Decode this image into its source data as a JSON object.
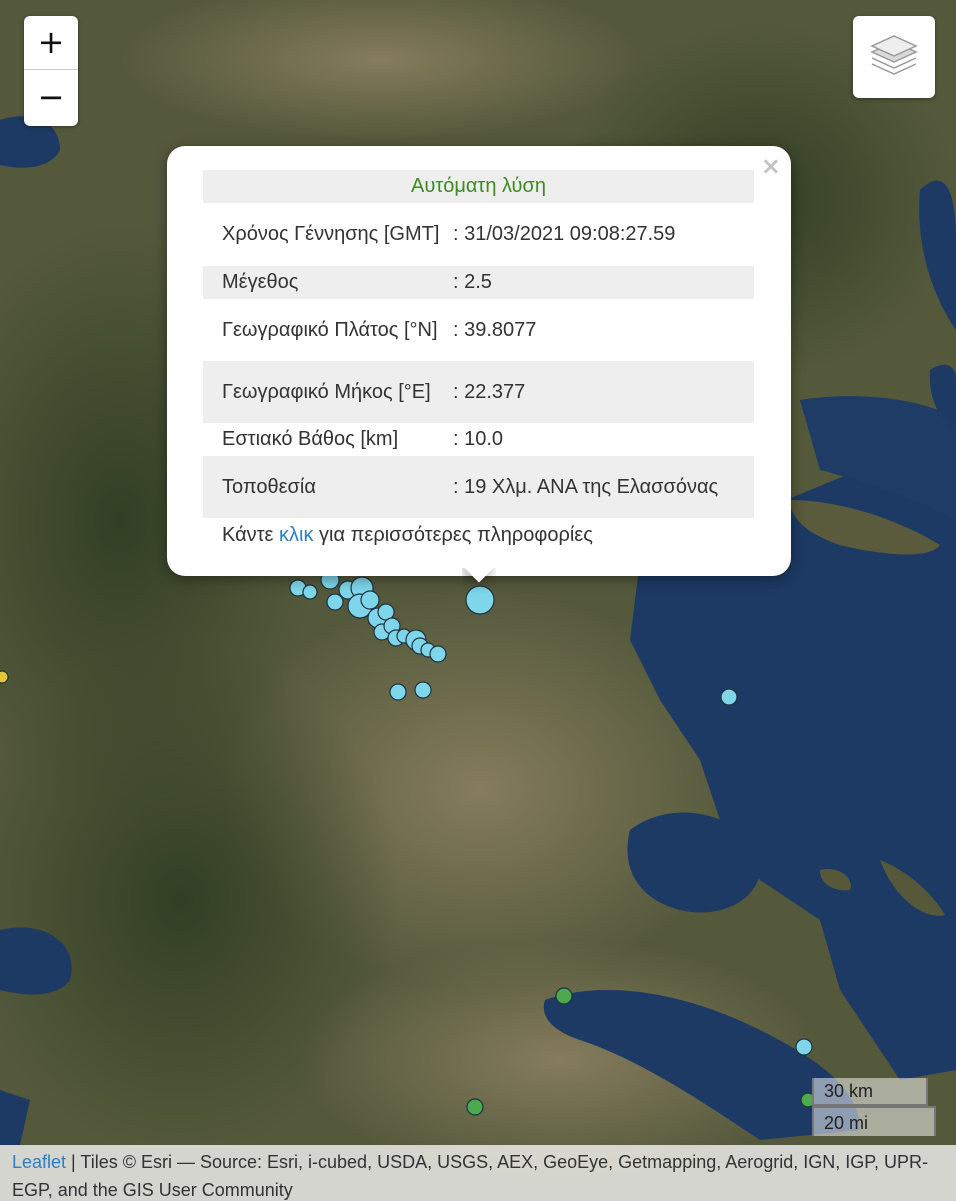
{
  "map": {
    "zoom_in_label": "+",
    "zoom_out_label": "−",
    "layers_icon": "layers-icon",
    "colors": {
      "land_dark": "#3f4a2c",
      "land_light": "#7d7658",
      "sea": "#1d3a64",
      "marker_recent": "#7fd6ea",
      "marker_older": "#4caa4c",
      "marker_oldest": "#e2c43a"
    }
  },
  "popup": {
    "close_label": "×",
    "title": "Αυτόματη λύση",
    "rows": [
      {
        "label": "Χρόνος Γέννησης [GMT]",
        "value": ": 31/03/2021 09:08:27.59"
      },
      {
        "label": "Μέγεθος",
        "value": ": 2.5"
      },
      {
        "label": "Γεωγραφικό Πλάτος [°N]",
        "value": ": 39.8077"
      },
      {
        "label": "Γεωγραφικό Μήκος [°E]",
        "value": ": 22.377"
      },
      {
        "label": "Εστιακό Βάθος [km]",
        "value": ": 10.0"
      },
      {
        "label": "Τοποθεσία",
        "value": ": 19 Χλμ. ΑΝΑ της Ελασσόνας"
      }
    ],
    "more_prefix": "Κάντε ",
    "more_link": "κλικ",
    "more_suffix": " για περισσότερες πληροφορίες"
  },
  "scale": {
    "km": "30 km",
    "mi": "20 mi"
  },
  "attribution": {
    "link": "Leaflet",
    "text": " | Tiles © Esri — Source: Esri, i-cubed, USDA, USGS, AEX, GeoEye, Getmapping, Aerogrid, IGN, IGP, UPR-EGP, and the GIS User Community"
  }
}
